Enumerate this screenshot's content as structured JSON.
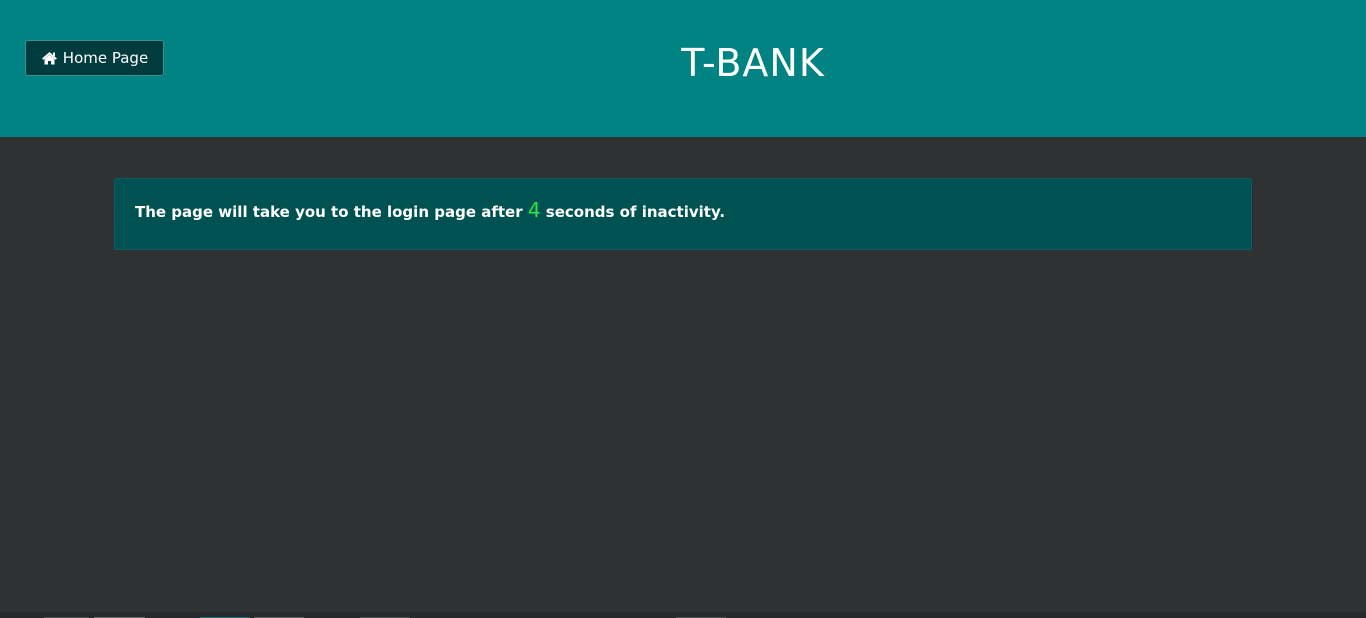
{
  "header": {
    "title": "T-BANK",
    "home_button": {
      "icon": "home-icon",
      "label": "Home Page"
    }
  },
  "alert": {
    "text_before": "The page will take you to the login page after ",
    "countdown": "4",
    "text_after": " seconds of inactivity."
  },
  "colors": {
    "header_bg": "#018283",
    "page_bg": "#2e3233",
    "alert_bg": "#005152",
    "countdown": "#2ee54a"
  }
}
